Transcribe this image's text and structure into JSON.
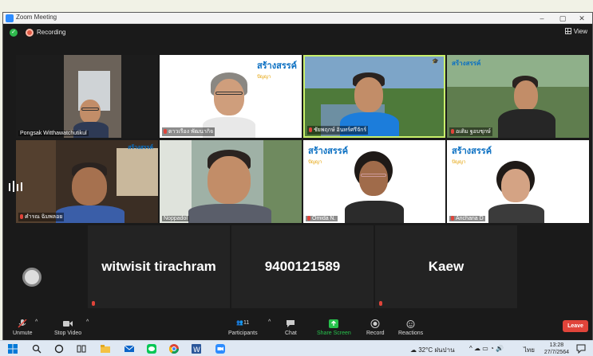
{
  "window": {
    "title": "Zoom Meeting"
  },
  "meeting": {
    "recording_label": "Recording",
    "view_label": "View"
  },
  "participants": [
    {
      "name": "Pongsak Witthawatchutikul"
    },
    {
      "name": "ดาวเรือง พัฒนากิจ"
    },
    {
      "name": "ชัยพฤกษ์ อินทร์ศรีจักร์"
    },
    {
      "name": "อเดิม ฐอบชุกษ์"
    },
    {
      "name": "คำรณ ฉิมพลอย"
    },
    {
      "name": "Noppadol"
    },
    {
      "name": "Omida N."
    },
    {
      "name": "Anchana D"
    },
    {
      "name": "witwisit tirachram"
    },
    {
      "name": "9400121589"
    },
    {
      "name": "Kaew"
    }
  ],
  "banner": {
    "title": "สร้างสรรค์",
    "subtitle": "ปัญญา"
  },
  "toolbar": {
    "unmute": "Unmute",
    "stop_video": "Stop Video",
    "participants": "Participants",
    "participants_count": "11",
    "chat": "Chat",
    "share_screen": "Share Screen",
    "record": "Record",
    "reactions": "Reactions",
    "leave": "Leave"
  },
  "taskbar": {
    "weather": "32°C",
    "weather_desc": "ฝนปาน",
    "language": "ไทย",
    "time": "13:28",
    "date": "27/7/2564"
  },
  "colors": {
    "accent": "#2d8cff",
    "leave": "#e0443a",
    "share": "#27c24c",
    "active_speaker": "#c9f06b"
  }
}
